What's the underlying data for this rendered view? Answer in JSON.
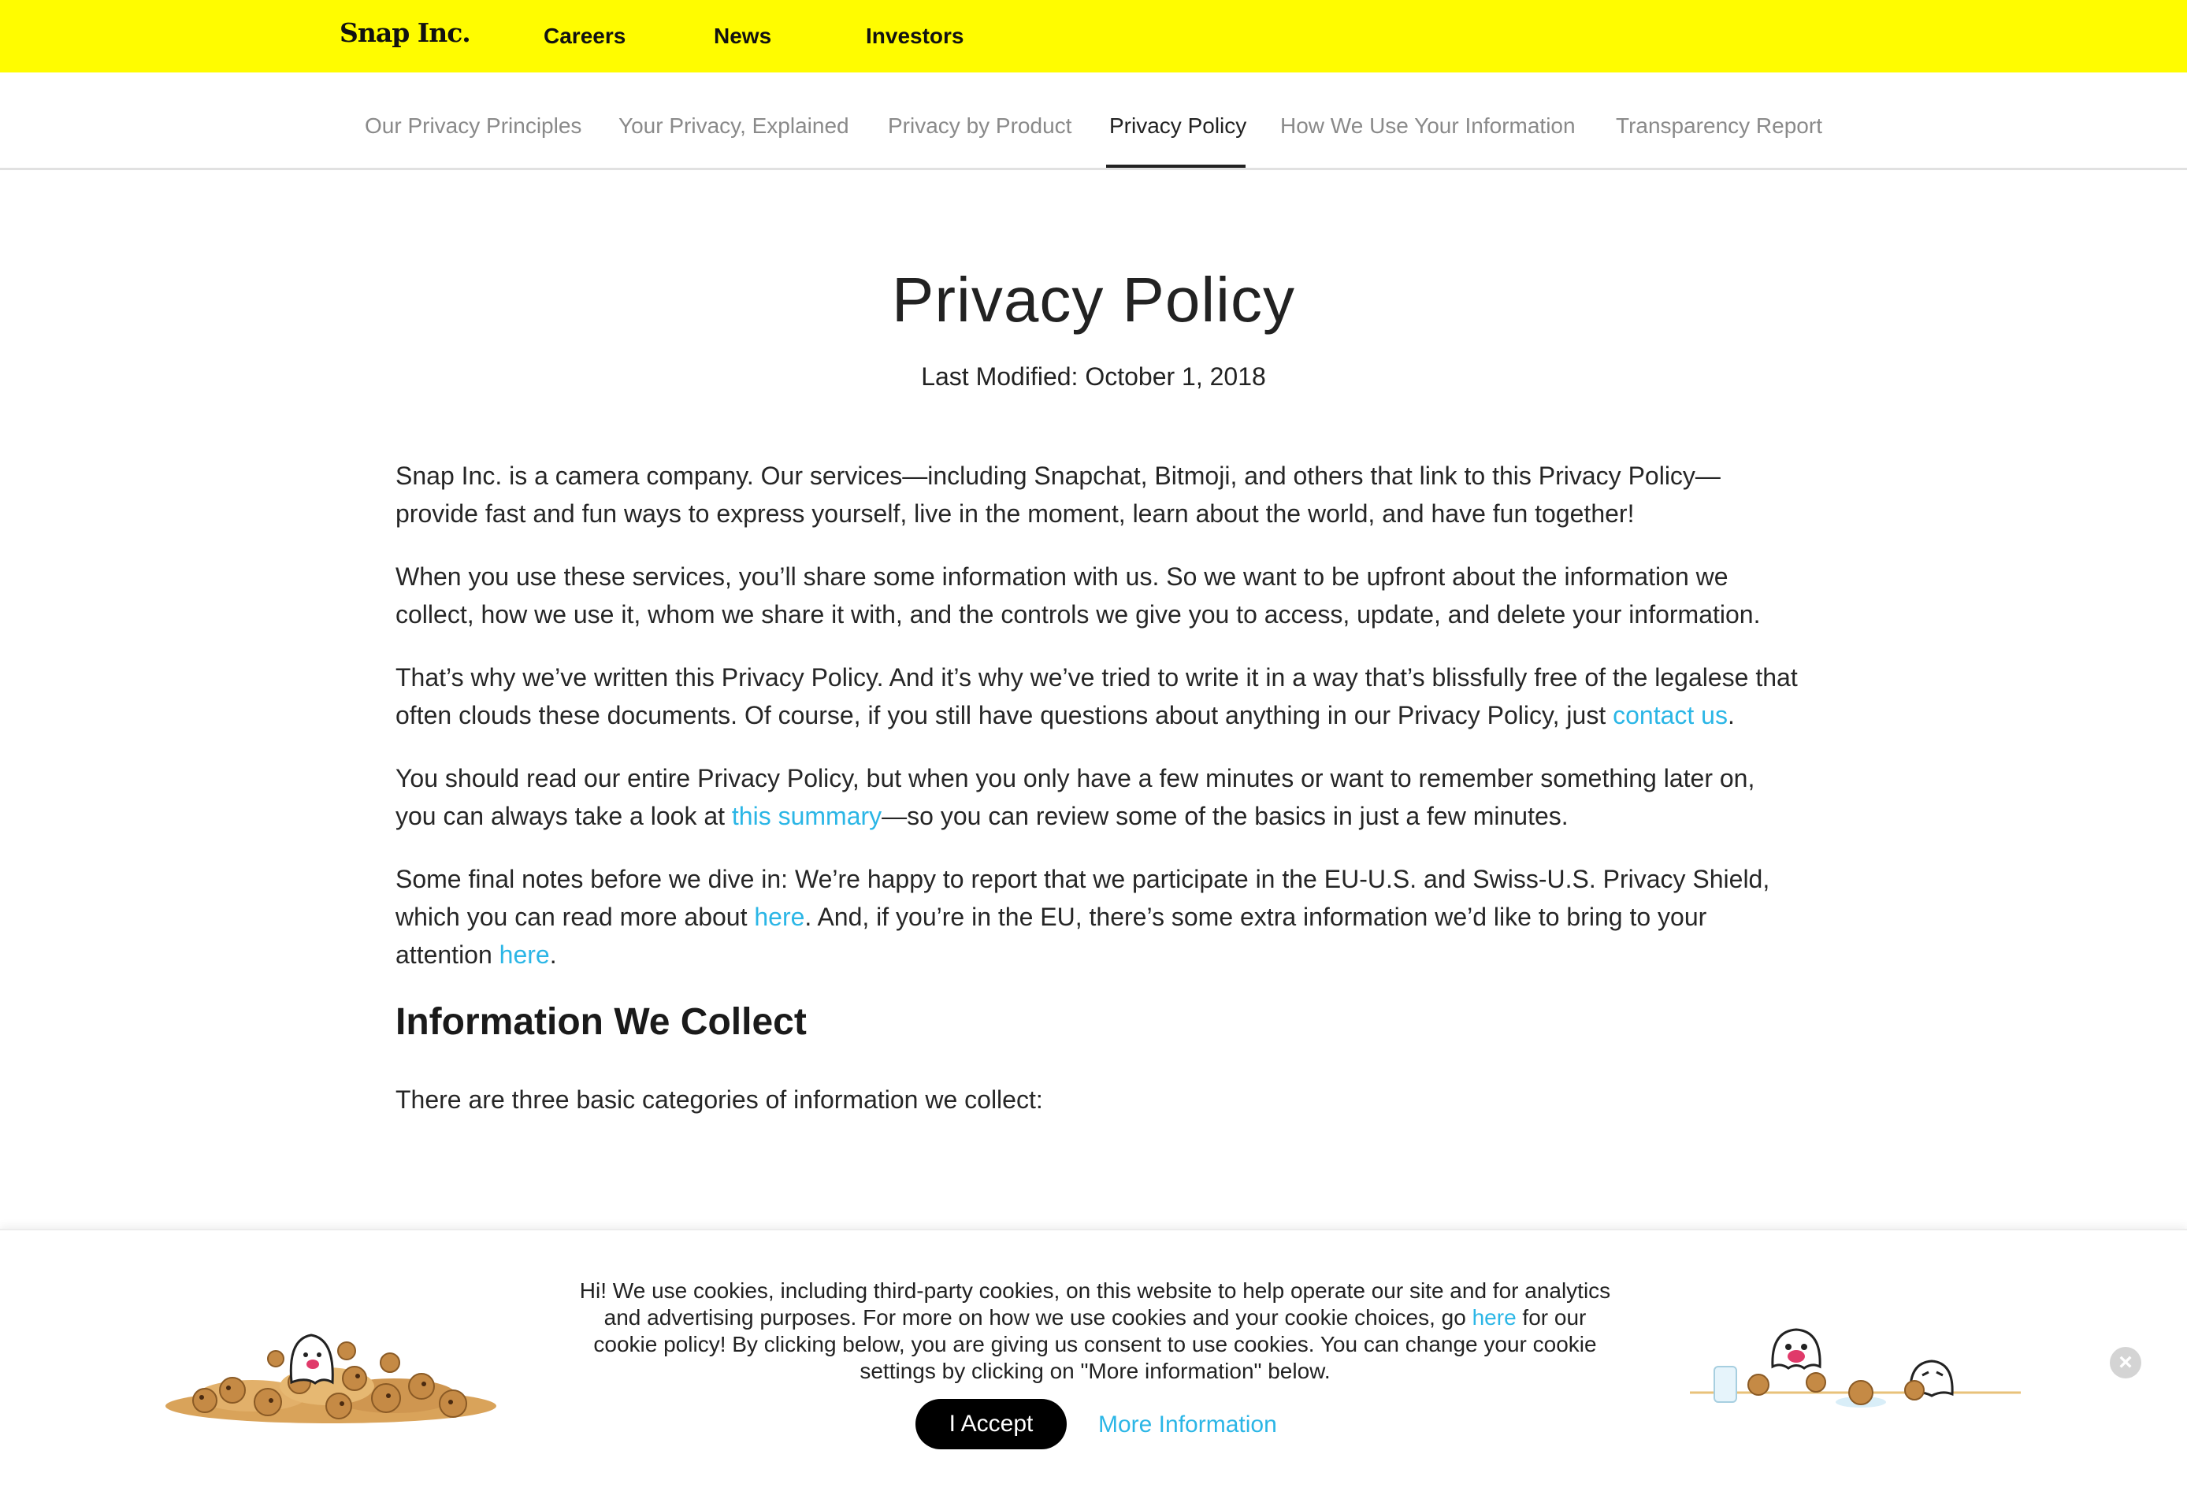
{
  "topbar": {
    "logo": "Snap Inc.",
    "links": [
      "Careers",
      "News",
      "Investors"
    ]
  },
  "subnav": {
    "tabs": [
      "Our Privacy Principles",
      "Your Privacy, Explained",
      "Privacy by Product",
      "Privacy Policy",
      "How We Use Your Information",
      "Transparency Report"
    ],
    "active": "Privacy Policy"
  },
  "page": {
    "title": "Privacy Policy",
    "modified": "Last Modified: October 1, 2018"
  },
  "content": {
    "p1": "Snap Inc. is a camera company. Our services—including Snapchat, Bitmoji, and others that link to this Privacy Policy—provide fast and fun ways to express yourself, live in the moment, learn about the world, and have fun together!",
    "p2": "When you use these services, you’ll share some information with us. So we want to be upfront about the information we collect, how we use it, whom we share it with, and the controls we give you to access, update, and delete your information.",
    "p3_before": "That’s why we’ve written this Privacy Policy. And it’s why we’ve tried to write it in a way that’s blissfully free of the legalese that often clouds these documents. Of course, if you still have questions about anything in our Privacy Policy, just ",
    "p3_link": "contact us",
    "p3_after": ".",
    "p4_before": "You should read our entire Privacy Policy, but when you only have a few minutes or want to remember something later on, you can always take a look at ",
    "p4_link": "this summary",
    "p4_after": "—so you can review some of the basics in just a few minutes.",
    "p5_before": "Some final notes before we dive in: We’re happy to report that we participate in the EU-U.S. and Swiss-U.S. Privacy Shield, which you can read more about ",
    "p5_link1": "here",
    "p5_middle": ". And, if you’re in the EU, there’s some extra information we’d like to bring to your attention ",
    "p5_link2": "here",
    "p5_after": ".",
    "heading": "Information We Collect",
    "p6": "There are three basic categories of information we collect:"
  },
  "cookie_banner": {
    "text_before": "Hi! We use cookies, including third-party cookies, on this website to help operate our site and for analytics and advertising purposes. For more on how we use cookies and your cookie choices, go ",
    "text_link": "here",
    "text_after": " for our cookie policy! By clicking below, you are giving us consent to use cookies. You can change your cookie settings by clicking on \"More information\" below.",
    "accept_label": "I Accept",
    "more_label": "More Information",
    "close_icon": "close-icon",
    "left_illustration": "ghost-cookie-pile-illustration",
    "right_illustration": "ghosts-milk-cookies-illustration"
  },
  "colors": {
    "brand_yellow": "#fffc00",
    "link_blue": "#2bb6e6",
    "text_dark": "#262626",
    "tab_inactive": "#8a8a8a"
  }
}
